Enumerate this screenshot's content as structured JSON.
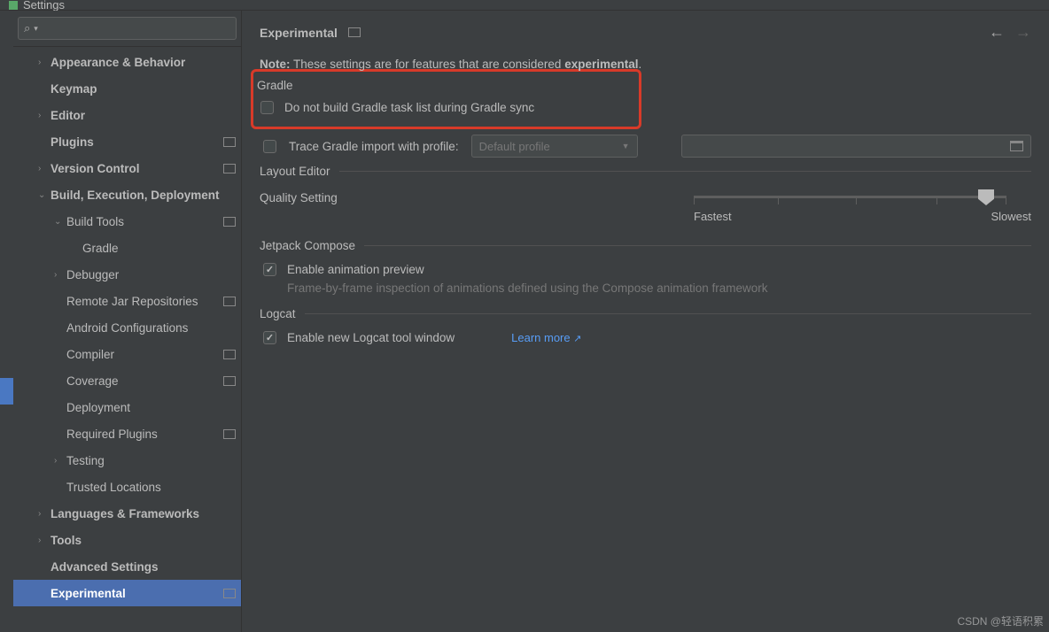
{
  "window": {
    "title": "Settings"
  },
  "sidebar": {
    "items": [
      {
        "label": "Appearance & Behavior",
        "bold": true,
        "arrow": ">",
        "proj": false,
        "level": 1
      },
      {
        "label": "Keymap",
        "bold": true,
        "arrow": "",
        "proj": false,
        "level": 1
      },
      {
        "label": "Editor",
        "bold": true,
        "arrow": ">",
        "proj": false,
        "level": 1
      },
      {
        "label": "Plugins",
        "bold": true,
        "arrow": "",
        "proj": true,
        "level": 1
      },
      {
        "label": "Version Control",
        "bold": true,
        "arrow": ">",
        "proj": true,
        "level": 1
      },
      {
        "label": "Build, Execution, Deployment",
        "bold": true,
        "arrow": "v",
        "proj": false,
        "level": 1
      },
      {
        "label": "Build Tools",
        "bold": false,
        "arrow": "v",
        "proj": true,
        "level": 2
      },
      {
        "label": "Gradle",
        "bold": false,
        "arrow": "",
        "proj": false,
        "level": 3
      },
      {
        "label": "Debugger",
        "bold": false,
        "arrow": ">",
        "proj": false,
        "level": 2
      },
      {
        "label": "Remote Jar Repositories",
        "bold": false,
        "arrow": "",
        "proj": true,
        "level": 2
      },
      {
        "label": "Android Configurations",
        "bold": false,
        "arrow": "",
        "proj": false,
        "level": 2
      },
      {
        "label": "Compiler",
        "bold": false,
        "arrow": "",
        "proj": true,
        "level": 2
      },
      {
        "label": "Coverage",
        "bold": false,
        "arrow": "",
        "proj": true,
        "level": 2
      },
      {
        "label": "Deployment",
        "bold": false,
        "arrow": "",
        "proj": false,
        "level": 2
      },
      {
        "label": "Required Plugins",
        "bold": false,
        "arrow": "",
        "proj": true,
        "level": 2
      },
      {
        "label": "Testing",
        "bold": false,
        "arrow": ">",
        "proj": false,
        "level": 2
      },
      {
        "label": "Trusted Locations",
        "bold": false,
        "arrow": "",
        "proj": false,
        "level": 2
      },
      {
        "label": "Languages & Frameworks",
        "bold": true,
        "arrow": ">",
        "proj": false,
        "level": 1
      },
      {
        "label": "Tools",
        "bold": true,
        "arrow": ">",
        "proj": false,
        "level": 1
      },
      {
        "label": "Advanced Settings",
        "bold": true,
        "arrow": "",
        "proj": false,
        "level": 1
      },
      {
        "label": "Experimental",
        "bold": true,
        "arrow": "",
        "proj": true,
        "level": 1,
        "selected": true
      }
    ]
  },
  "content": {
    "title": "Experimental",
    "note_strong1": "Note:",
    "note_mid": " These settings are for features that are considered ",
    "note_strong2": "experimental",
    "note_end": ".",
    "gradle": {
      "header": "Gradle",
      "cb1": "Do not build Gradle task list during Gradle sync",
      "cb2": "Trace Gradle import with profile:",
      "combo": "Default profile"
    },
    "layout": {
      "header": "Layout Editor",
      "quality": "Quality Setting",
      "fastest": "Fastest",
      "slowest": "Slowest"
    },
    "jetpack": {
      "header": "Jetpack Compose",
      "cb": "Enable animation preview",
      "hint": "Frame-by-frame inspection of animations defined using the Compose animation framework"
    },
    "logcat": {
      "header": "Logcat",
      "cb": "Enable new Logcat tool window",
      "link": "Learn more"
    }
  },
  "watermark": "CSDN @轻语积累"
}
